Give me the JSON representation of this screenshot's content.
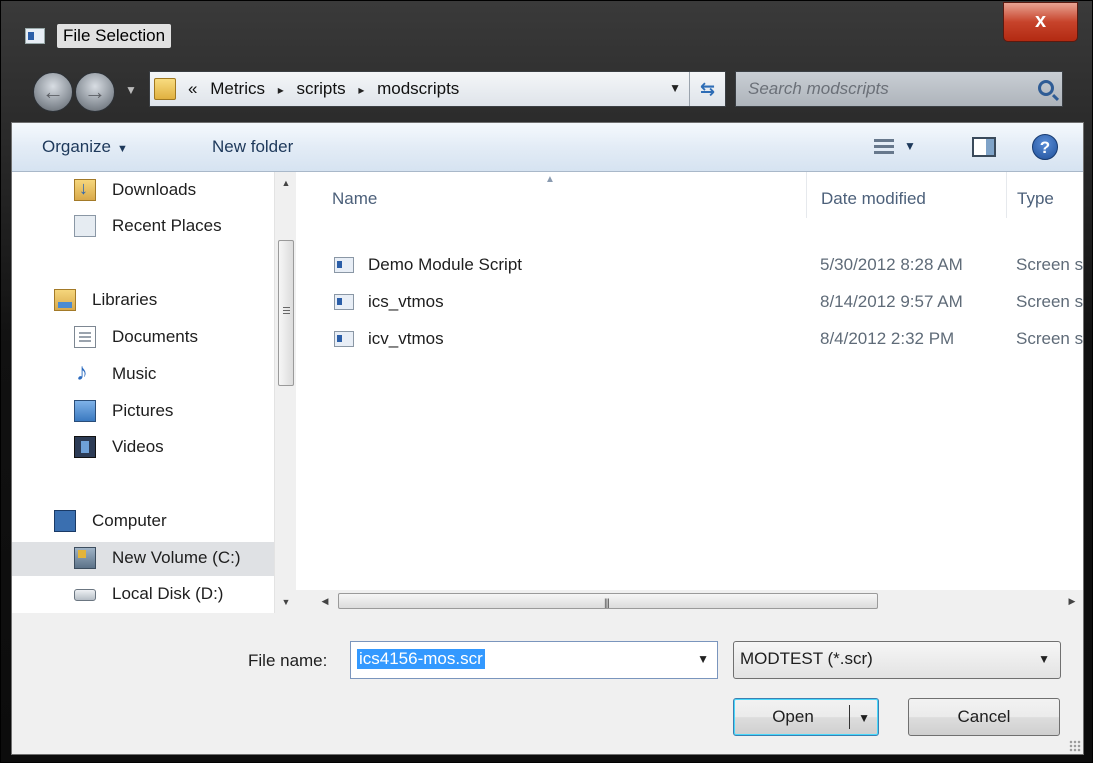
{
  "window": {
    "title": "File Selection",
    "close_label": "x"
  },
  "nav": {
    "breadcrumb_prefix": "«",
    "breadcrumb": [
      "Metrics",
      "scripts",
      "modscripts"
    ],
    "breadcrumb_separator": "▸",
    "search_placeholder": "Search modscripts"
  },
  "toolbar": {
    "organize_label": "Organize",
    "new_folder_label": "New folder",
    "help_label": "?"
  },
  "sidebar": {
    "items": [
      {
        "label": "Downloads",
        "icon": "downloads-icon"
      },
      {
        "label": "Recent Places",
        "icon": "recent-places-icon"
      },
      {
        "label": "Libraries",
        "icon": "libraries-icon"
      },
      {
        "label": "Documents",
        "icon": "documents-icon"
      },
      {
        "label": "Music",
        "icon": "music-icon"
      },
      {
        "label": "Pictures",
        "icon": "pictures-icon"
      },
      {
        "label": "Videos",
        "icon": "videos-icon"
      },
      {
        "label": "Computer",
        "icon": "computer-icon"
      },
      {
        "label": "New Volume (C:)",
        "icon": "drive-icon",
        "selected": true
      },
      {
        "label": "Local Disk (D:)",
        "icon": "disk-icon"
      }
    ]
  },
  "filelist": {
    "columns": [
      "Name",
      "Date modified",
      "Type"
    ],
    "rows": [
      {
        "name": "Demo Module Script",
        "date": "5/30/2012 8:28 AM",
        "type": "Screen sav"
      },
      {
        "name": "ics_vtmos",
        "date": "8/14/2012 9:57 AM",
        "type": "Screen sav"
      },
      {
        "name": "icv_vtmos",
        "date": "8/4/2012 2:32 PM",
        "type": "Screen sav"
      }
    ]
  },
  "footer": {
    "file_name_label": "File name:",
    "file_name_value": "ics4156-mos.scr",
    "filter_value": "MODTEST (*.scr)",
    "open_label": "Open",
    "cancel_label": "Cancel"
  },
  "colors": {
    "selection": "#3399ff",
    "toolbar_text": "#1e395b",
    "close_button": "#c7432b"
  }
}
